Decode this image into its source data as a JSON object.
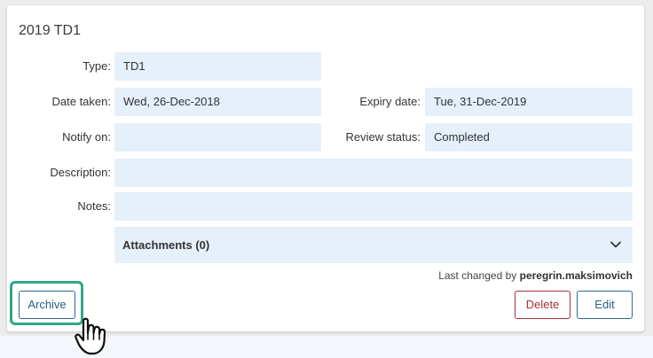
{
  "record": {
    "title": "2019 TD1"
  },
  "fields": {
    "type_label": "Type:",
    "type_value": "TD1",
    "date_taken_label": "Date taken:",
    "date_taken_value": "Wed, 26-Dec-2018",
    "expiry_label": "Expiry date:",
    "expiry_value": "Tue, 31-Dec-2019",
    "notify_label": "Notify on:",
    "notify_value": "",
    "review_label": "Review status:",
    "review_value": "Completed",
    "description_label": "Description:",
    "description_value": "",
    "notes_label": "Notes:",
    "notes_value": ""
  },
  "attachments": {
    "label": "Attachments (0)",
    "icon": "chevron-down-icon"
  },
  "footer": {
    "last_changed_prefix": "Last changed by",
    "last_changed_user": "peregrin.maksimovich"
  },
  "actions": {
    "archive_label": "Archive",
    "delete_label": "Delete",
    "edit_label": "Edit"
  },
  "colors": {
    "field_bg": "#e5f0fa",
    "primary_outline": "#2b6a93",
    "danger_outline": "#a13333",
    "highlight": "#2fa88a"
  },
  "pointer": {
    "icon": "hand-pointer-icon"
  }
}
